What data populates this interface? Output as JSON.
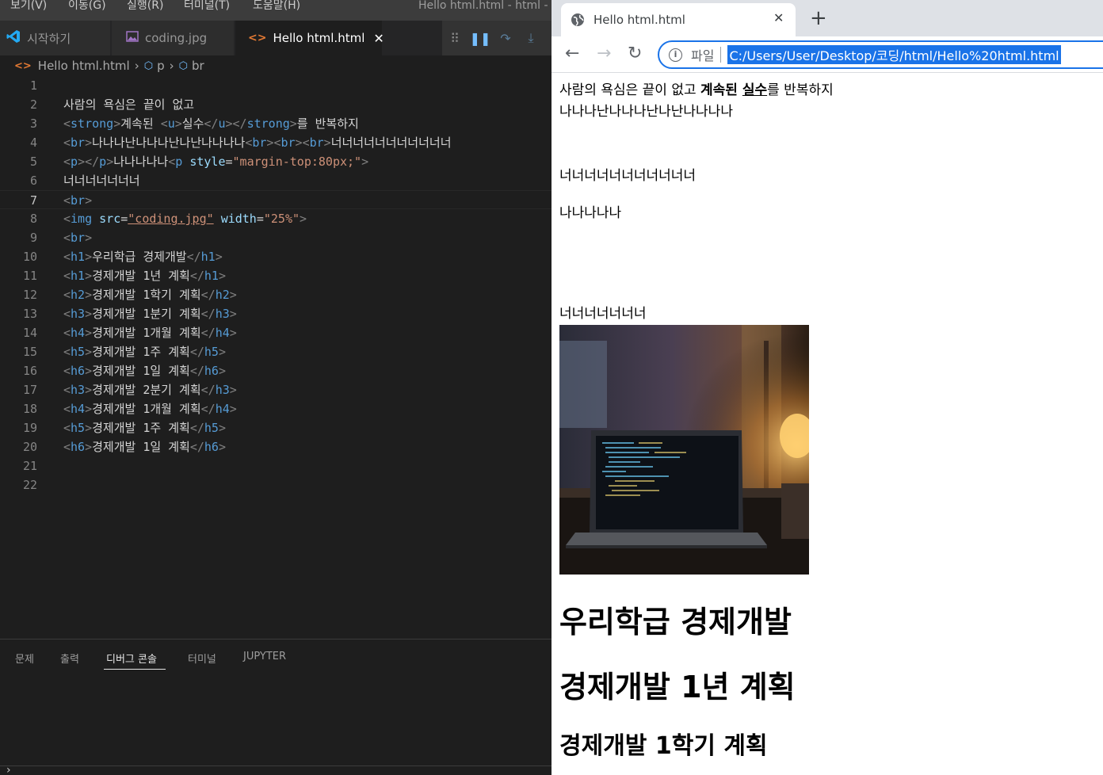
{
  "vscode": {
    "menu": [
      "보기(V)",
      "이동(G)",
      "실행(R)",
      "터미널(T)",
      "도움말(H)"
    ],
    "window_title": "Hello html.html - html - V",
    "tabs": [
      {
        "label": "시작하기",
        "icon": "vscode-logo-icon",
        "active": false
      },
      {
        "label": "coding.jpg",
        "icon": "image-file-icon",
        "active": false
      },
      {
        "label": "Hello html.html",
        "icon": "html-file-icon",
        "active": true,
        "close": "✕"
      }
    ],
    "debug_toolbar": [
      "drag-handle-icon",
      "pause-icon",
      "step-over-icon",
      "step-into-icon"
    ],
    "breadcrumb": {
      "file": "Hello html.html",
      "p": "p",
      "br": "br"
    },
    "current_line": 7,
    "lines": [
      {
        "n": "1"
      },
      {
        "n": "2"
      },
      {
        "n": "3"
      },
      {
        "n": "4"
      },
      {
        "n": "5"
      },
      {
        "n": "6"
      },
      {
        "n": "7"
      },
      {
        "n": "8"
      },
      {
        "n": "9"
      },
      {
        "n": "10"
      },
      {
        "n": "11"
      },
      {
        "n": "12"
      },
      {
        "n": "13"
      },
      {
        "n": "14"
      },
      {
        "n": "15"
      },
      {
        "n": "16"
      },
      {
        "n": "17"
      },
      {
        "n": "18"
      },
      {
        "n": "19"
      },
      {
        "n": "20"
      },
      {
        "n": "21"
      },
      {
        "n": "22"
      }
    ],
    "code": {
      "l2": "사람의 욕심은 끝이 없고",
      "l3_text1": "계속된 ",
      "l3_text2": "실수",
      "l3_text3": "를 반복하지",
      "l4_text1": "나나나난나나나난나난나나나나",
      "l4_text2": "너너너너너너너너너너너",
      "l5_text": "나나나나나",
      "l5_attr": "style",
      "l5_val": "\"margin-top:80px;\"",
      "l6": "너너너너너너너",
      "l8_src": "src",
      "l8_srcval": "\"coding.jpg\"",
      "l8_width": "width",
      "l8_widthval": "\"25%\"",
      "headings": [
        {
          "tag": "h1",
          "text": "우리학급 경제개발",
          "close": "h1"
        },
        {
          "tag": "h1",
          "text": "경제개발 1년 계획",
          "close": "h1"
        },
        {
          "tag": "h2",
          "text": "경제개발 1학기 계획",
          "close": "h2"
        },
        {
          "tag": "h3",
          "text": "경제개발 1분기 계획",
          "close": "h3"
        },
        {
          "tag": "h4",
          "text": "경제개발 1개월 계획",
          "close": "h4"
        },
        {
          "tag": "h5",
          "text": "경제개발 1주 계획",
          "close": "h5"
        },
        {
          "tag": "h6",
          "text": "경제개발 1일 계획",
          "close": "h6"
        },
        {
          "tag": "h3",
          "text": "경제개발 2분기 계획",
          "close": "h3"
        },
        {
          "tag": "h4",
          "text": "경제개발 1개월 계획",
          "close": "h4"
        },
        {
          "tag": "h5",
          "text": "경제개발 1주 계획",
          "close": "h5"
        },
        {
          "tag": "h6",
          "text": "경제개발 1일 계획",
          "close": "h6"
        }
      ]
    },
    "panel_tabs": [
      "문제",
      "출력",
      "디버그 콘솔",
      "터미널",
      "JUPYTER"
    ],
    "active_panel": "디버그 콘솔"
  },
  "browser": {
    "tab_title": "Hello html.html",
    "tab_close": "✕",
    "new_tab": "+",
    "nav": {
      "back": "←",
      "forward": "→",
      "reload": "↻"
    },
    "address_label": "파일",
    "address_sep": "|",
    "url": "C:/Users/User/Desktop/코딩/html/Hello%20html.html",
    "page": {
      "line1_a": "사람의 욕심은 끝이 없고 ",
      "line1_strong": "계속된 ",
      "line1_u": "실수",
      "line1_b": "를 반복하지",
      "line2": "나나나난나나나난나난나나나나",
      "line3": "너너너너너너너너너너너",
      "line4": "나나나나나",
      "line5": "너너너너너너너",
      "h1a": "우리학급 경제개발",
      "h1b": "경제개발 1년 계획",
      "h2": "경제개발 1학기 계획"
    }
  }
}
